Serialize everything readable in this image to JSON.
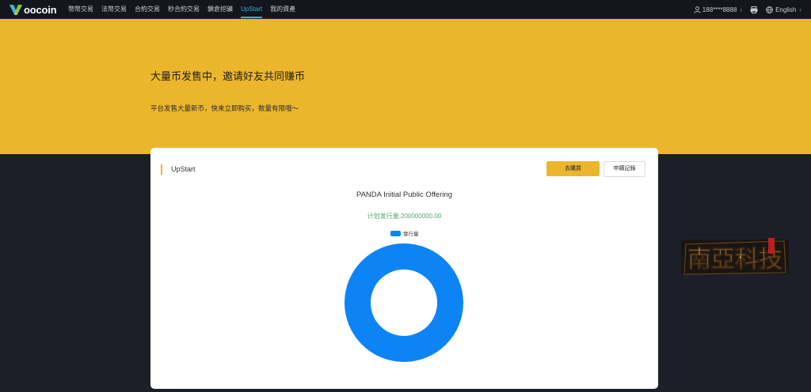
{
  "app": {
    "logo_text": "oocoin",
    "colors": {
      "brand_yellow": "#ebb62c",
      "active_tab": "#2fb5d6",
      "chart_blue": "#0d84f5",
      "plan_green": "#55a868"
    }
  },
  "nav": {
    "items": [
      {
        "label": "幣幣交易"
      },
      {
        "label": "法幣交易"
      },
      {
        "label": "合約交易"
      },
      {
        "label": "秒合約交易"
      },
      {
        "label": "鎖倉挖礦"
      },
      {
        "label": "UpStart",
        "active": true
      },
      {
        "label": "我的資產"
      }
    ],
    "user": "188****8888",
    "user_icon": "user-icon",
    "language": "English",
    "language_icon": "globe-icon",
    "mobile_icon": "printer-icon"
  },
  "banner": {
    "headline": "大量币发售中，邀请好友共同赚币",
    "subline": "平台发售大量新币，快来立即购买，数量有限哦～"
  },
  "card": {
    "title": "UpStart",
    "buy_button": "去購買",
    "record_button": "申購記錄",
    "ipo_title": "PANDA Initial Public Offering",
    "plan_text": "计划发行量:200000000.00"
  },
  "chart_data": {
    "type": "pie",
    "donut": true,
    "legend": [
      "發行量"
    ],
    "legend_position": "top",
    "series": [
      {
        "name": "發行量",
        "values": [
          200000000.0
        ]
      }
    ],
    "colors": [
      "#0d84f5"
    ]
  },
  "watermark": {
    "text": "南亞科技"
  }
}
